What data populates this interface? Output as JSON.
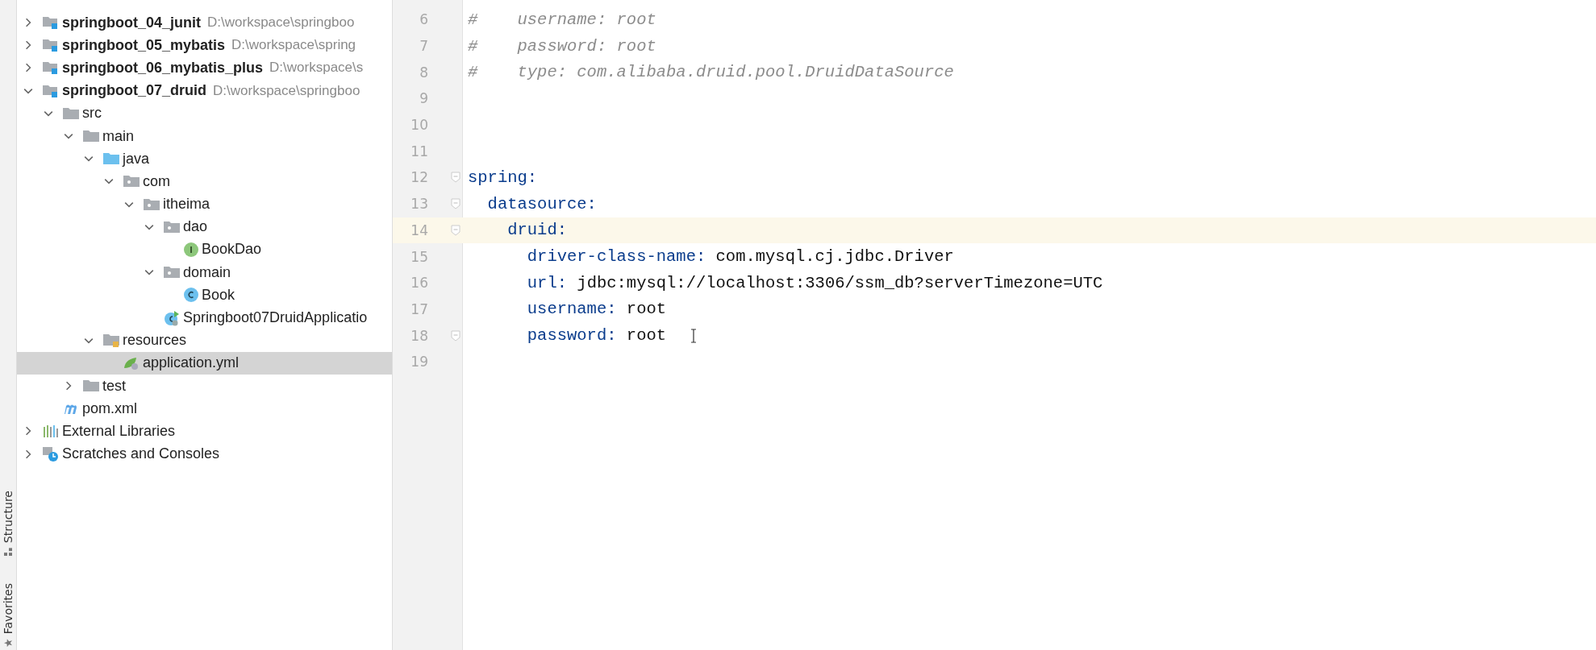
{
  "side_tabs": [
    {
      "label": "Structure",
      "kind": "structure"
    },
    {
      "label": "Favorites",
      "kind": "favorites"
    }
  ],
  "project_tree": [
    {
      "name": "springboot_04_junit",
      "path": "D:\\workspace\\springboo",
      "kind": "module",
      "expanded": false,
      "selected": false
    },
    {
      "name": "springboot_05_mybatis",
      "path": "D:\\workspace\\spring",
      "kind": "module",
      "expanded": false,
      "selected": false
    },
    {
      "name": "springboot_06_mybatis_plus",
      "path": "D:\\workspace\\s",
      "kind": "module",
      "expanded": false,
      "selected": false
    },
    {
      "name": "springboot_07_druid",
      "path": "D:\\workspace\\springboo",
      "kind": "module",
      "expanded": true,
      "selected": false,
      "children": [
        {
          "name": "src",
          "kind": "folder",
          "expanded": true,
          "selected": false,
          "children": [
            {
              "name": "main",
              "kind": "folder",
              "expanded": true,
              "selected": false,
              "children": [
                {
                  "name": "java",
                  "kind": "source-folder",
                  "expanded": true,
                  "selected": false,
                  "children": [
                    {
                      "name": "com",
                      "kind": "package",
                      "expanded": true,
                      "selected": false,
                      "children": [
                        {
                          "name": "itheima",
                          "kind": "package",
                          "expanded": true,
                          "selected": false,
                          "children": [
                            {
                              "name": "dao",
                              "kind": "package",
                              "expanded": true,
                              "selected": false,
                              "children": [
                                {
                                  "name": "BookDao",
                                  "kind": "interface",
                                  "selected": false
                                }
                              ]
                            },
                            {
                              "name": "domain",
                              "kind": "package",
                              "expanded": true,
                              "selected": false,
                              "children": [
                                {
                                  "name": "Book",
                                  "kind": "class",
                                  "selected": false
                                }
                              ]
                            },
                            {
                              "name": "Springboot07DruidApplicatio",
                              "kind": "app-class",
                              "selected": false
                            }
                          ]
                        }
                      ]
                    }
                  ]
                },
                {
                  "name": "resources",
                  "kind": "resources-folder",
                  "expanded": true,
                  "selected": false,
                  "children": [
                    {
                      "name": "application.yml",
                      "kind": "yaml-file",
                      "selected": true
                    }
                  ]
                }
              ]
            },
            {
              "name": "test",
              "kind": "folder",
              "expanded": false,
              "selected": false
            }
          ]
        },
        {
          "name": "pom.xml",
          "kind": "maven-file",
          "selected": false
        }
      ]
    },
    {
      "name": "External Libraries",
      "kind": "libraries",
      "expanded": false,
      "selected": false
    },
    {
      "name": "Scratches and Consoles",
      "kind": "scratches",
      "expanded": false,
      "selected": false
    }
  ],
  "editor": {
    "lines": [
      {
        "number": "6",
        "kind": "comment",
        "text": "#    username: root"
      },
      {
        "number": "7",
        "kind": "comment",
        "text": "#    password: root"
      },
      {
        "number": "8",
        "kind": "comment",
        "text": "#    type: com.alibaba.druid.pool.DruidDataSource"
      },
      {
        "number": "9",
        "kind": "blank"
      },
      {
        "number": "10",
        "kind": "blank"
      },
      {
        "number": "11",
        "kind": "blank"
      },
      {
        "number": "12",
        "kind": "key",
        "key": "spring:",
        "fold_marker": true
      },
      {
        "number": "13",
        "kind": "key",
        "key": "  datasource:",
        "fold_marker": true
      },
      {
        "number": "14",
        "kind": "key",
        "key": "    druid:",
        "fold_marker": true,
        "current": true
      },
      {
        "number": "15",
        "kind": "pair",
        "key": "      driver-class-name:",
        "value": " com.mysql.cj.jdbc.Driver"
      },
      {
        "number": "16",
        "kind": "pair",
        "key": "      url:",
        "value": " jdbc:mysql://localhost:3306/ssm_db?serverTimezone=UTC"
      },
      {
        "number": "17",
        "kind": "pair",
        "key": "      username:",
        "value": " root"
      },
      {
        "number": "18",
        "kind": "pair",
        "key": "      password:",
        "value": " root",
        "fold_marker": true
      },
      {
        "number": "19",
        "kind": "blank"
      }
    ]
  }
}
